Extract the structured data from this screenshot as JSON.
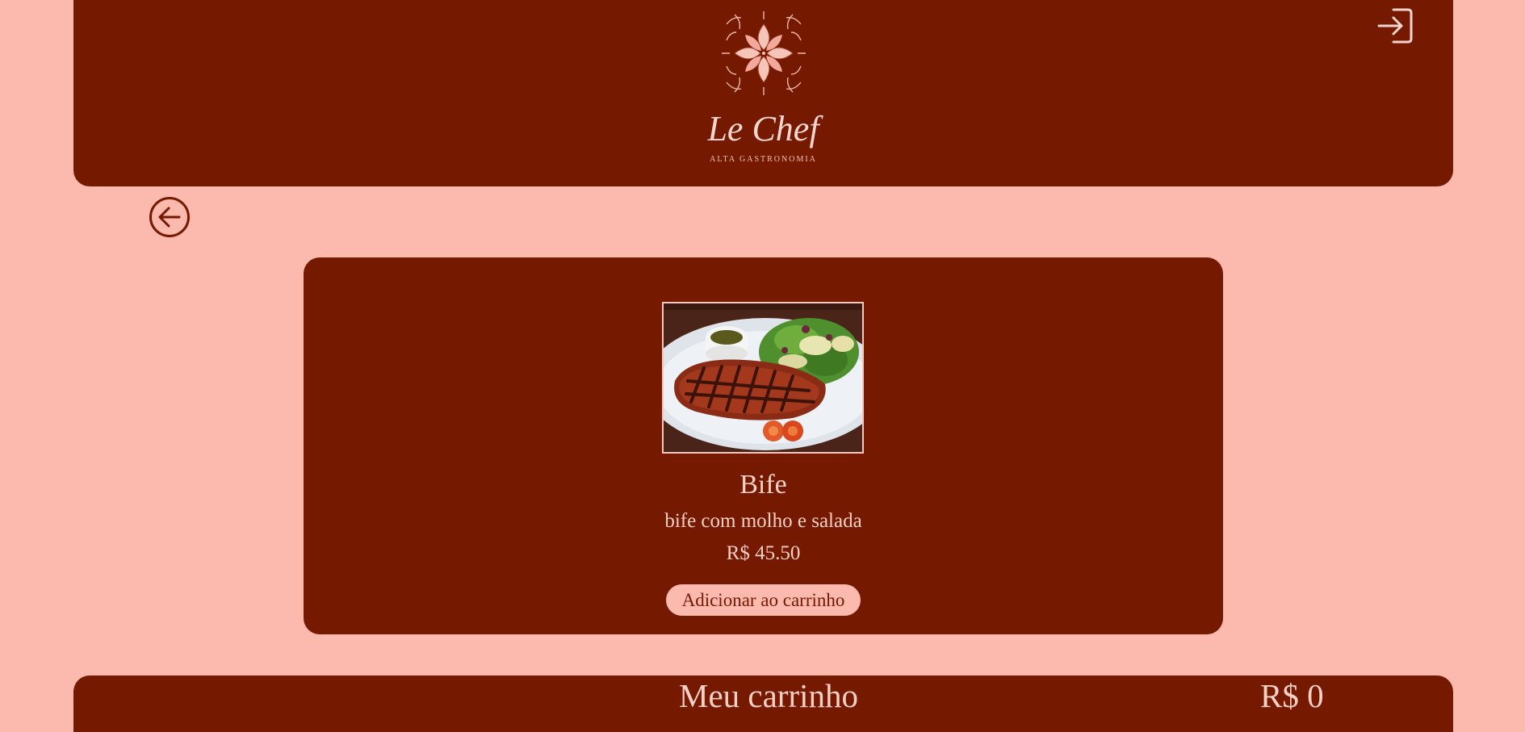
{
  "brand": {
    "name": "Le Chef",
    "tagline": "ALTA GASTRONOMIA",
    "logo_icon": "flower-emblem-icon"
  },
  "header": {
    "login_icon": "login-icon"
  },
  "navigation": {
    "back_icon": "arrow-left-circle-icon"
  },
  "product": {
    "name": "Bife",
    "description": "bife com molho e salada",
    "price": "R$ 45.50",
    "image_icon": "steak-plate-image",
    "add_button_label": "Adicionar ao carrinho"
  },
  "cart": {
    "title": "Meu carrinho",
    "total": "R$ 0"
  },
  "colors": {
    "background": "#fcb9ae",
    "primary": "#751901",
    "text_light": "#f9cfc6"
  }
}
